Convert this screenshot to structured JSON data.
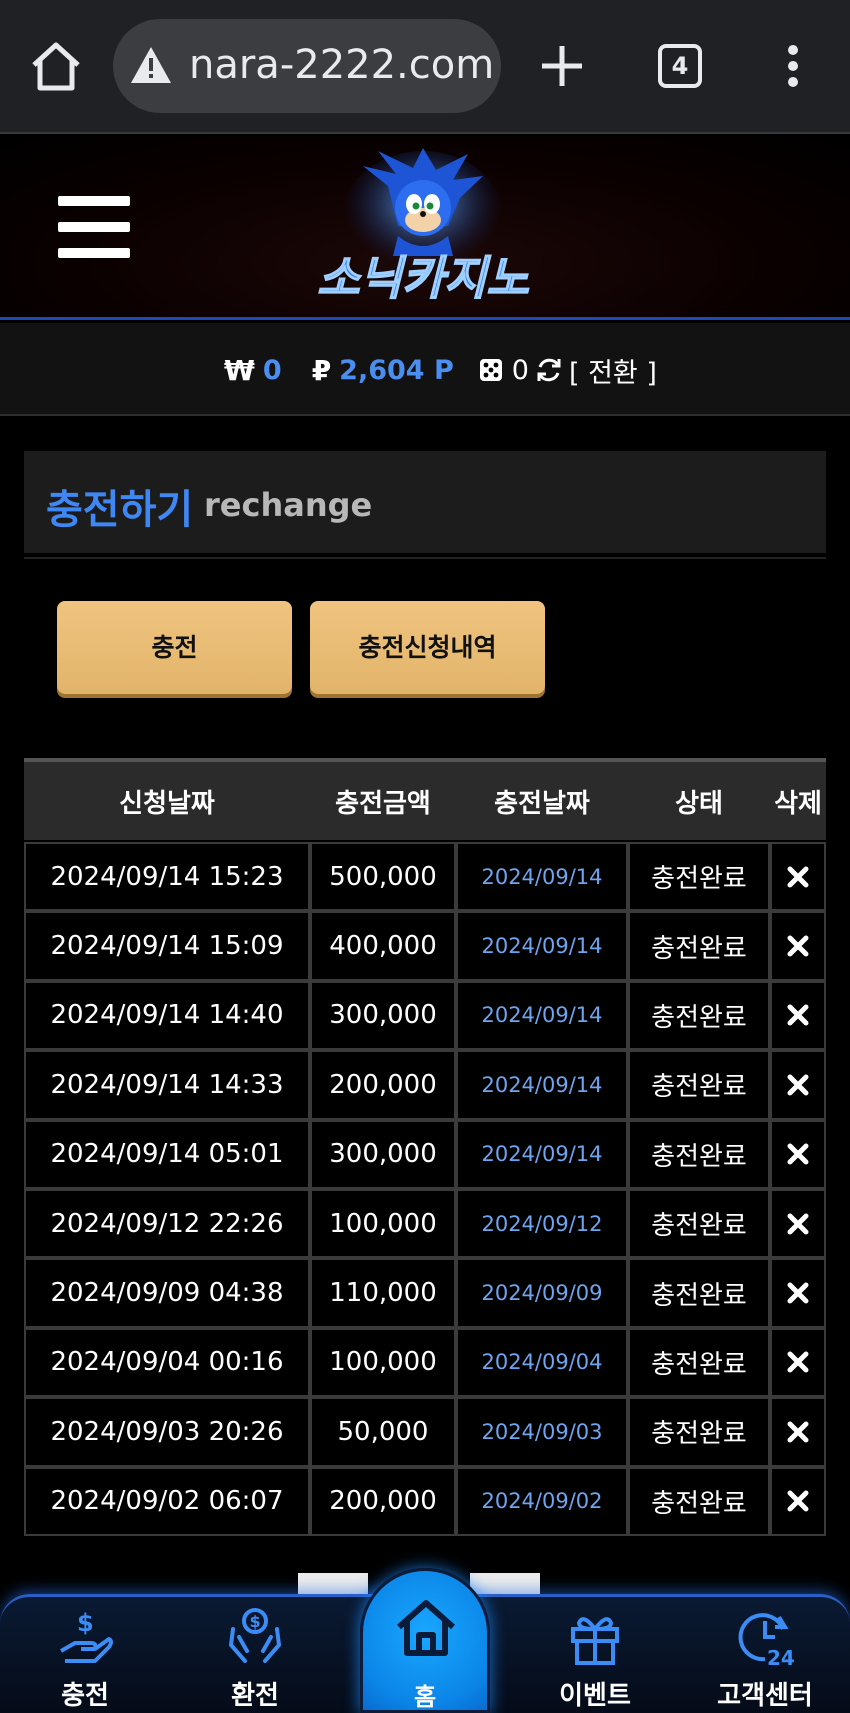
{
  "browser": {
    "url": "nara-2222.com",
    "tab_count": "4"
  },
  "site": {
    "logo_text": "소닉카지노"
  },
  "balance": {
    "won_symbol": "₩",
    "won_value": "0",
    "point_symbol": "₽",
    "point_value": "2,604 P",
    "dice_value": "0",
    "switch_label": "[ 전환 ]"
  },
  "section": {
    "title_ko": "충전하기",
    "title_en": "rechange"
  },
  "buttons": {
    "charge": "충전",
    "history": "충전신청내역"
  },
  "table": {
    "headers": [
      "신청날짜",
      "충전금액",
      "충전날짜",
      "상태",
      "삭제"
    ],
    "rows": [
      {
        "requested": "2024/09/14 15:23",
        "amount": "500,000",
        "charged": "2024/09/14",
        "status": "충전완료"
      },
      {
        "requested": "2024/09/14 15:09",
        "amount": "400,000",
        "charged": "2024/09/14",
        "status": "충전완료"
      },
      {
        "requested": "2024/09/14 14:40",
        "amount": "300,000",
        "charged": "2024/09/14",
        "status": "충전완료"
      },
      {
        "requested": "2024/09/14 14:33",
        "amount": "200,000",
        "charged": "2024/09/14",
        "status": "충전완료"
      },
      {
        "requested": "2024/09/14 05:01",
        "amount": "300,000",
        "charged": "2024/09/14",
        "status": "충전완료"
      },
      {
        "requested": "2024/09/12 22:26",
        "amount": "100,000",
        "charged": "2024/09/12",
        "status": "충전완료"
      },
      {
        "requested": "2024/09/09 04:38",
        "amount": "110,000",
        "charged": "2024/09/09",
        "status": "충전완료"
      },
      {
        "requested": "2024/09/04 00:16",
        "amount": "100,000",
        "charged": "2024/09/04",
        "status": "충전완료"
      },
      {
        "requested": "2024/09/03 20:26",
        "amount": "50,000",
        "charged": "2024/09/03",
        "status": "충전완료"
      },
      {
        "requested": "2024/09/02 06:07",
        "amount": "200,000",
        "charged": "2024/09/02",
        "status": "충전완료"
      }
    ]
  },
  "nav": {
    "charge": "충전",
    "exchange": "환전",
    "home": "홈",
    "event": "이벤트",
    "support": "고객센터"
  },
  "colors": {
    "accent_blue": "#3f87f5",
    "button_gold": "#e8b870",
    "nav_blue": "#1aa7ff"
  }
}
